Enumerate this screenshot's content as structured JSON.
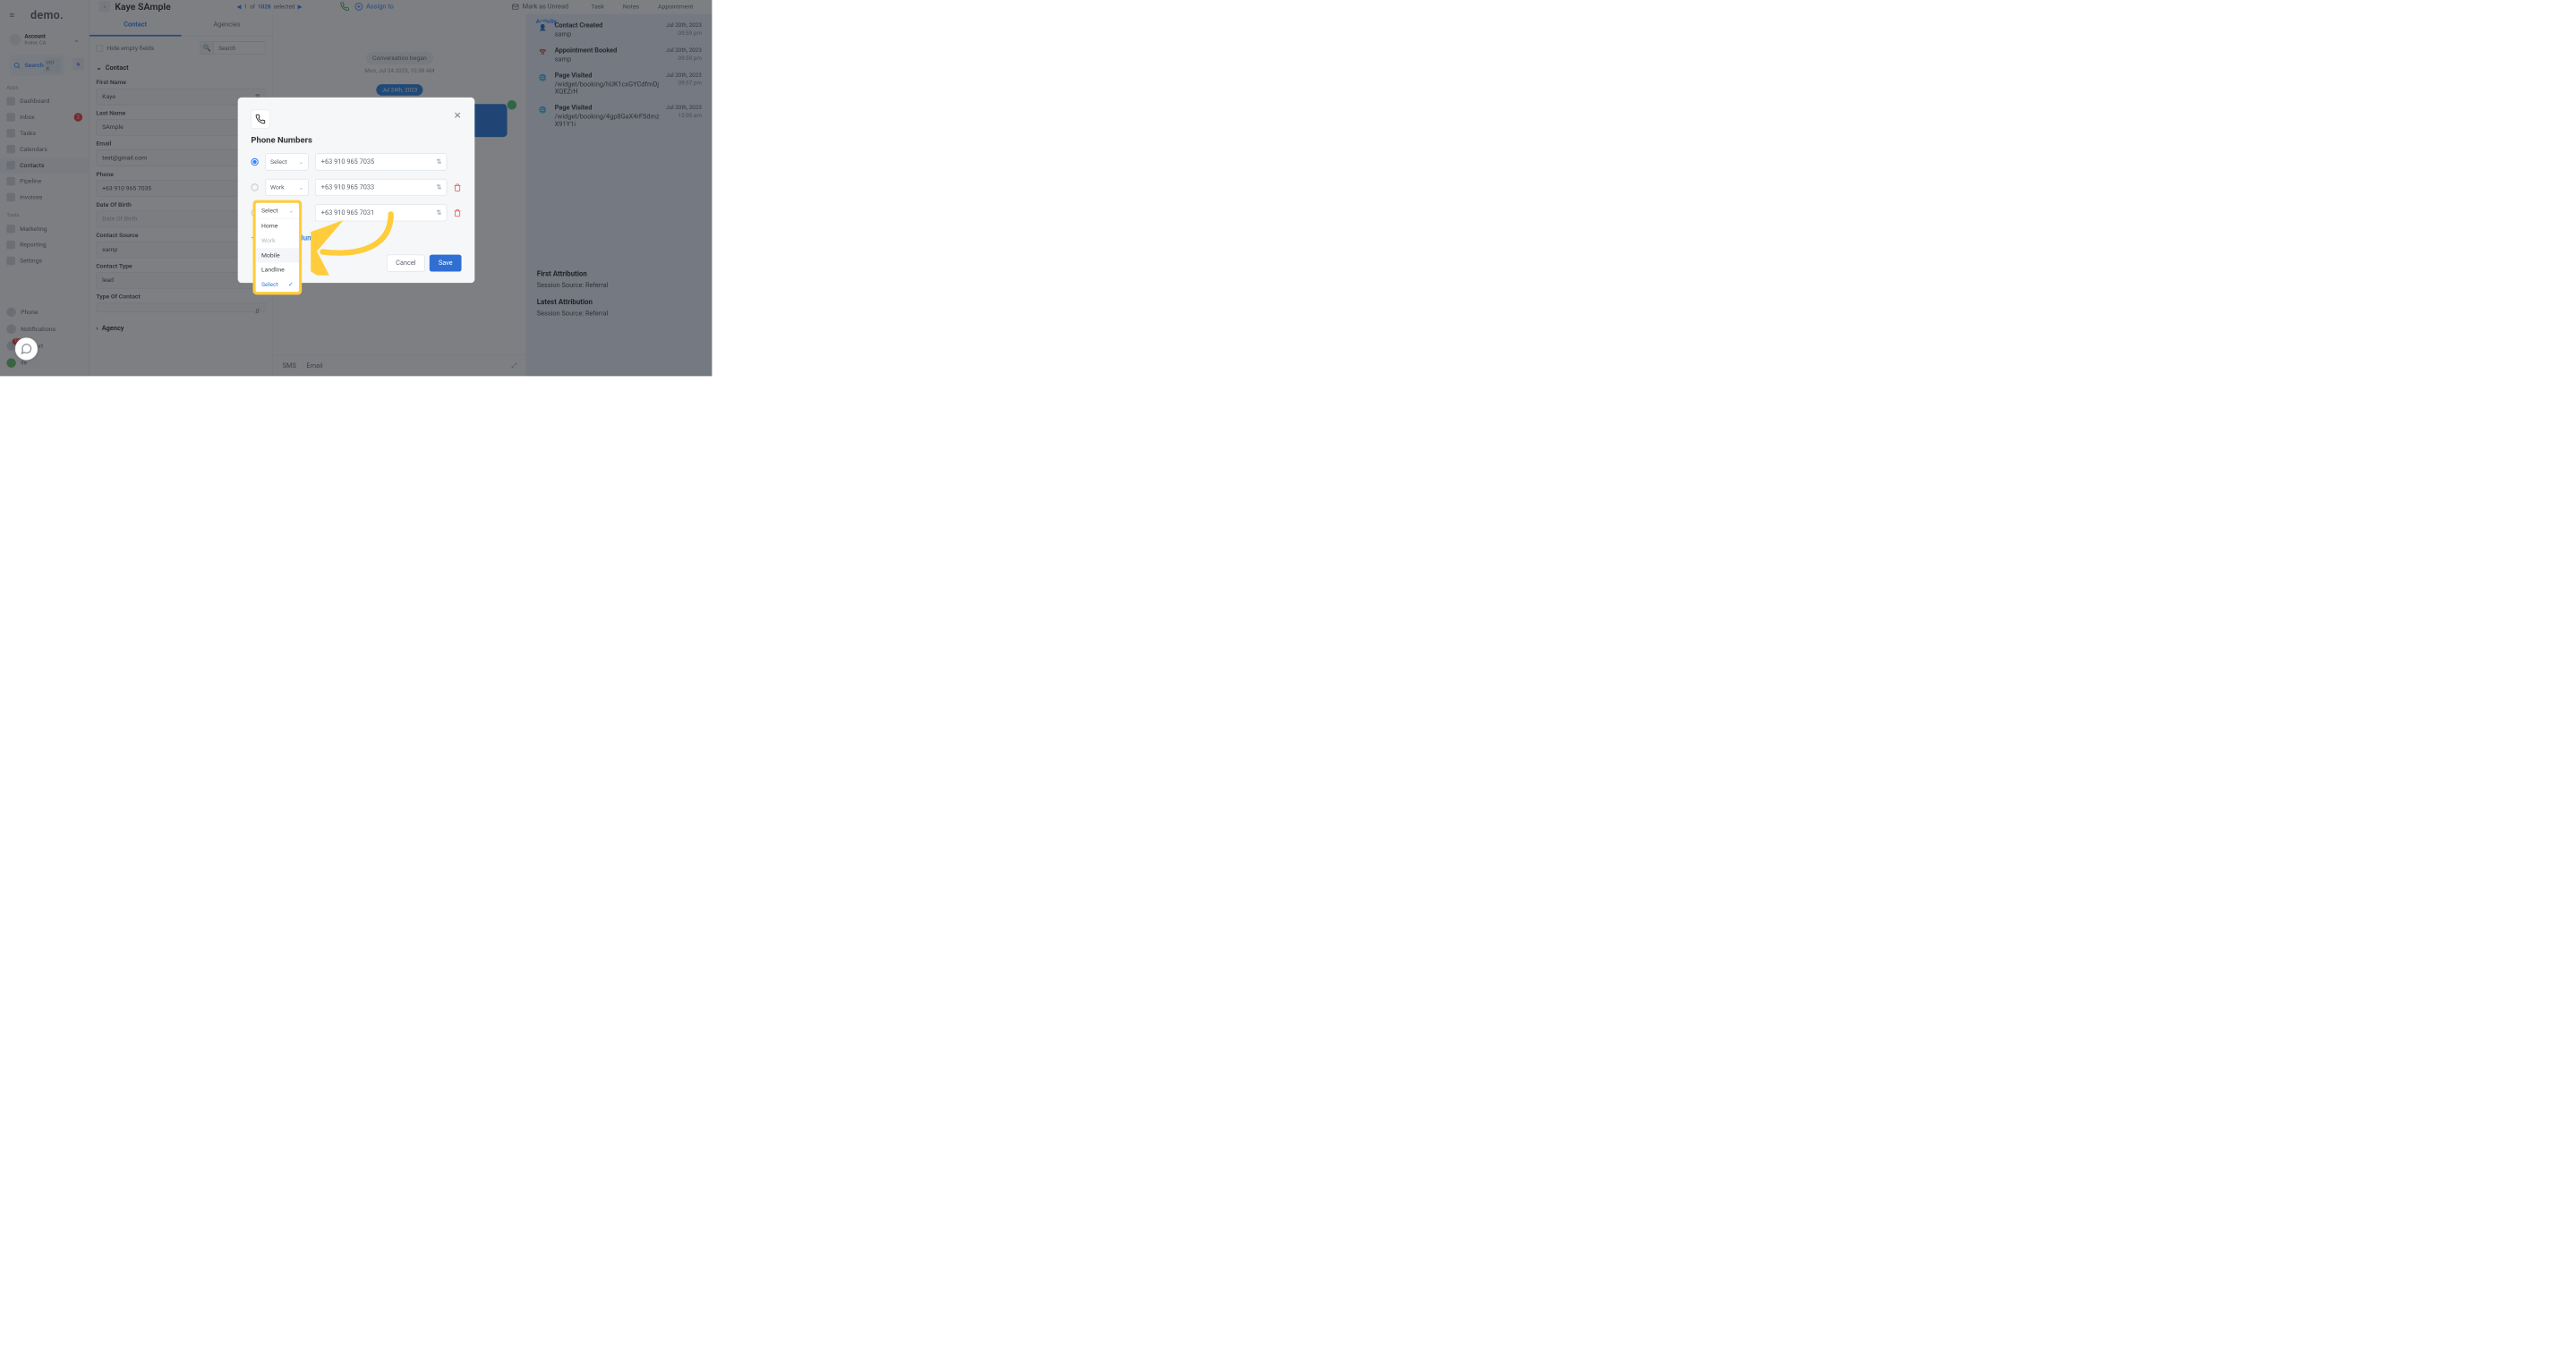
{
  "brand": "demo.",
  "account": {
    "label": "Account",
    "sub": "Irvine, CA"
  },
  "search": {
    "label": "Search",
    "kbd": "ctrl K"
  },
  "sections": {
    "apps": "Apps",
    "tools": "Tools"
  },
  "nav": {
    "dashboard": "Dashboard",
    "inbox": "Inbox",
    "inbox_badge": "2",
    "tasks": "Tasks",
    "calendars": "Calendars",
    "contacts": "Contacts",
    "pipeline": "Pipeline",
    "invoices": "Invoices",
    "marketing": "Marketing",
    "reporting": "Reporting",
    "settings": "Settings",
    "phone": "Phone",
    "notifications": "Notifications",
    "support": "ort",
    "support_badge": "19",
    "profile": "ile"
  },
  "header": {
    "name": "Kaye SAmple",
    "pager": {
      "cur": "1",
      "of": "of",
      "total": "1028",
      "sel": "selected"
    },
    "assign": "Assign to",
    "mark_unread": "Mark as Unread",
    "tabs": {
      "activity": "Activity",
      "task": "Task",
      "notes": "Notes",
      "appointment": "Appointment"
    }
  },
  "ctabs": {
    "contact": "Contact",
    "agencies": "Agencies"
  },
  "cpanel": {
    "hide_empty": "Hide empty fields",
    "search_ph": "Search",
    "section": "Contact",
    "first_name_l": "First Name",
    "first_name_v": "Kaye",
    "last_name_l": "Last Name",
    "last_name_v": "SAmple",
    "email_l": "Email",
    "email_v": "test@gmail.com",
    "phone_l": "Phone",
    "phone_v": "+63 910 965 7035",
    "dob_l": "Date Of Birth",
    "dob_ph": "Date Of Birth",
    "src_l": "Contact Source",
    "src_v": "samp",
    "type_l": "Contact Type",
    "type_v": "lead",
    "toc_l": "Type Of Contact",
    "agency": "Agency"
  },
  "conv": {
    "began": "Conversation began",
    "began_dt": "Mon, Jul 24 2023, 10:38 AM",
    "date_chip": "Jul 24th, 2023",
    "sms": "SMS",
    "email": "Email"
  },
  "activity": [
    {
      "title": "Contact Created",
      "sub": "samp",
      "date": "Jul 20th, 2023",
      "time": "09:59 pm"
    },
    {
      "title": "Appointment Booked",
      "sub": "samp",
      "date": "Jul 20th, 2023",
      "time": "09:59 pm"
    },
    {
      "title": "Page Visited",
      "sub": "/widget/booking/hUK1cxGYCdfmDjXQEZrH",
      "date": "Jul 20th, 2023",
      "time": "09:57 pm"
    },
    {
      "title": "Page Visited",
      "sub": "/widget/booking/4gp8GaX4rFSdmzX91Y1i",
      "date": "Jul 20th, 2023",
      "time": "12:05 am"
    }
  ],
  "attr": {
    "first_h": "First Attribution",
    "first_v": "Session Source: Referral",
    "latest_h": "Latest Attribution",
    "latest_v": "Session Source: Referral"
  },
  "modal": {
    "title": "Phone Numbers",
    "rows": [
      {
        "type": "Select",
        "num": "+63 910 965 7035",
        "primary": true
      },
      {
        "type": "Work",
        "num": "+63 910 965 7033",
        "primary": false
      },
      {
        "type": "Select",
        "num": "+63 910 965 7031",
        "primary": false
      }
    ],
    "add": "Add Phone Number",
    "cancel": "Cancel",
    "save": "Save"
  },
  "dd": {
    "head": "Select",
    "home": "Home",
    "work": "Work",
    "mobile": "Mobile",
    "landline": "Landline",
    "select": "Select"
  }
}
